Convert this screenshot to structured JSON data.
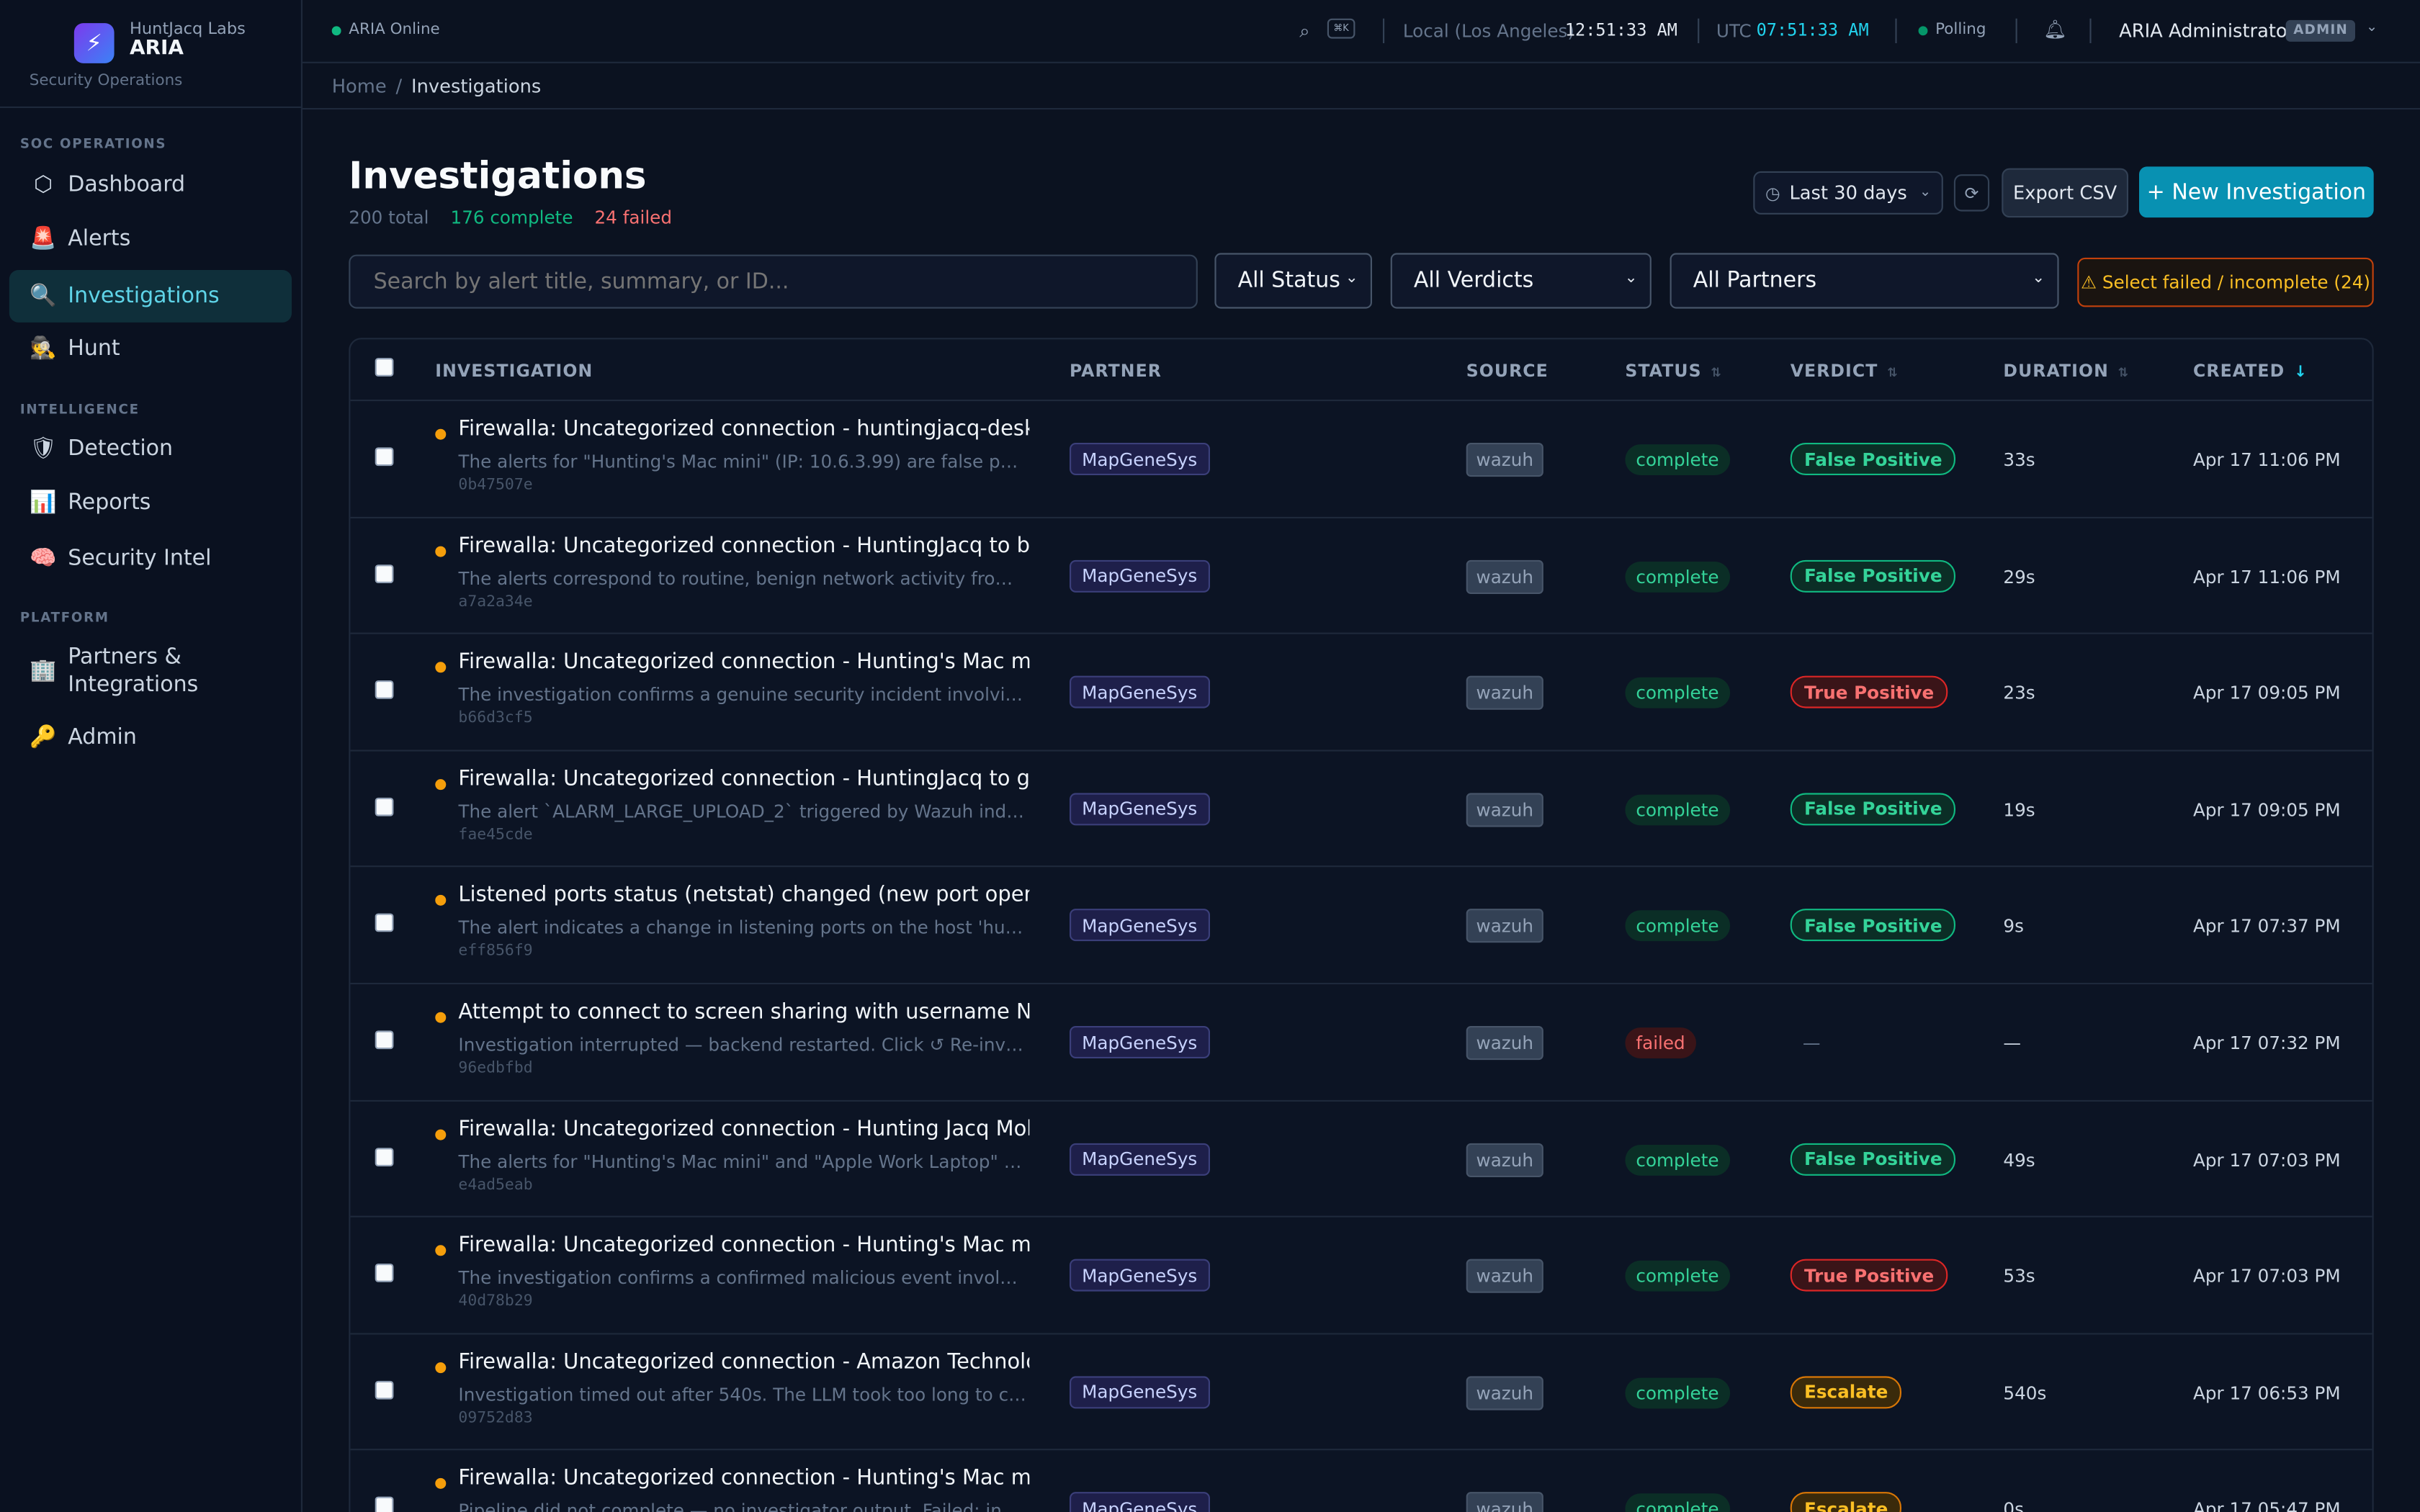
{
  "brand": {
    "org": "HuntJacq Labs",
    "name": "ARIA",
    "subtitle": "Security Operations"
  },
  "sidebar": {
    "sections": [
      {
        "label": "SOC OPERATIONS"
      },
      {
        "label": "INTELLIGENCE"
      },
      {
        "label": "PLATFORM"
      }
    ],
    "items": [
      {
        "label": "Dashboard",
        "icon": "hexagon-icon",
        "glyph": "⬡"
      },
      {
        "label": "Alerts",
        "icon": "siren-icon",
        "glyph": "🚨"
      },
      {
        "label": "Investigations",
        "icon": "magnifier-icon",
        "glyph": "🔍",
        "active": true
      },
      {
        "label": "Hunt",
        "icon": "detective-icon",
        "glyph": "🕵"
      },
      {
        "label": "Detection",
        "icon": "shield-icon",
        "glyph": "🛡"
      },
      {
        "label": "Reports",
        "icon": "chart-icon",
        "glyph": "📊"
      },
      {
        "label": "Security Intel",
        "icon": "brain-icon",
        "glyph": "🧠"
      },
      {
        "label": "Partners & Integrations",
        "icon": "building-icon",
        "glyph": "🏢"
      },
      {
        "label": "Admin",
        "icon": "key-icon",
        "glyph": "🔑"
      }
    ]
  },
  "topbar": {
    "status": "ARIA Online",
    "kbd": "⌘K",
    "local_label": "Local (Los Angeles)",
    "local_time": "12:51:33 AM",
    "utc_label": "UTC",
    "utc_time": "07:51:33 AM",
    "polling": "Polling",
    "user": "ARIA Administrator",
    "role": "ADMIN"
  },
  "breadcrumb": {
    "home": "Home",
    "current": "Investigations"
  },
  "page": {
    "title": "Investigations",
    "total": "200 total",
    "complete": "176 complete",
    "failed": "24 failed",
    "range": "Last 30 days",
    "export": "Export CSV",
    "new": "+ New Investigation"
  },
  "filters": {
    "search_placeholder": "Search by alert title, summary, or ID...",
    "status": "All Status",
    "verdicts": "All Verdicts",
    "partners": "All Partners",
    "select_failed": "⚠ Select failed / incomplete (24)"
  },
  "table": {
    "columns": [
      "Investigation",
      "Partner",
      "Source",
      "Status",
      "Verdict",
      "Duration",
      "Created"
    ],
    "rows": [
      {
        "title": "Firewalla: Uncategorized connection - huntingjacq-desktop to",
        "summary": "The alerts for \"Hunting's Mac mini\" (IP: 10.6.3.99) are false positives ...",
        "id": "0b47507e",
        "partner": "MapGeneSys",
        "source": "wazuh",
        "status": "complete",
        "verdict": "False Positive",
        "vclass": "fp",
        "duration": "33s",
        "created": "Apr 17 11:06 PM"
      },
      {
        "title": "Firewalla: Uncategorized connection - HuntingJacq to bag.itu",
        "summary": "The alerts correspond to routine, benign network activity from the u...",
        "id": "a7a2a34e",
        "partner": "MapGeneSys",
        "source": "wazuh",
        "status": "complete",
        "verdict": "False Positive",
        "vclass": "fp",
        "duration": "29s",
        "created": "Apr 17 11:06 PM"
      },
      {
        "title": "Firewalla: Uncategorized connection - Hunting's Mac mini to",
        "summary": "The investigation confirms a genuine security incident involving the ...",
        "id": "b66d3cf5",
        "partner": "MapGeneSys",
        "source": "wazuh",
        "status": "complete",
        "verdict": "True Positive",
        "vclass": "tp",
        "duration": "23s",
        "created": "Apr 17 09:05 PM"
      },
      {
        "title": "Firewalla: Uncategorized connection - HuntingJacq to gatewa",
        "summary": "The alert `ALARM_LARGE_UPLOAD_2` triggered by Wazuh indicates a...",
        "id": "fae45cde",
        "partner": "MapGeneSys",
        "source": "wazuh",
        "status": "complete",
        "verdict": "False Positive",
        "vclass": "fp",
        "duration": "19s",
        "created": "Apr 17 09:05 PM"
      },
      {
        "title": "Listened ports status (netstat) changed (new port opened or",
        "summary": "The alert indicates a change in listening ports on the host 'huntings....",
        "id": "eff856f9",
        "partner": "MapGeneSys",
        "source": "wazuh",
        "status": "complete",
        "verdict": "False Positive",
        "vclass": "fp",
        "duration": "9s",
        "created": "Apr 17 07:37 PM"
      },
      {
        "title": "Attempt to connect to screen sharing with username N/A fro",
        "summary": "Investigation interrupted — backend restarted. Click ↺ Re-investigate.",
        "id": "96edbfbd",
        "partner": "MapGeneSys",
        "source": "wazuh",
        "status": "failed",
        "verdict": "—",
        "vclass": "none",
        "duration": "—",
        "created": "Apr 17 07:32 PM"
      },
      {
        "title": "Firewalla: Uncategorized connection - Hunting Jacq Mobile to",
        "summary": "The alerts for \"Hunting's Mac mini\" and \"Apple Work Laptop\" are fals...",
        "id": "e4ad5eab",
        "partner": "MapGeneSys",
        "source": "wazuh",
        "status": "complete",
        "verdict": "False Positive",
        "vclass": "fp",
        "duration": "49s",
        "created": "Apr 17 07:03 PM"
      },
      {
        "title": "Firewalla: Uncategorized connection - Hunting's Mac mini to",
        "summary": "The investigation confirms a confirmed malicious event involving th...",
        "id": "40d78b29",
        "partner": "MapGeneSys",
        "source": "wazuh",
        "status": "complete",
        "verdict": "True Positive",
        "vclass": "tp",
        "duration": "53s",
        "created": "Apr 17 07:03 PM"
      },
      {
        "title": "Firewalla: Uncategorized connection - Amazon Technologies",
        "summary": "Investigation timed out after 540s. The LLM took too long to comple...",
        "id": "09752d83",
        "partner": "MapGeneSys",
        "source": "wazuh",
        "status": "complete",
        "verdict": "Escalate",
        "vclass": "es",
        "duration": "540s",
        "created": "Apr 17 06:53 PM"
      },
      {
        "title": "Firewalla: Uncategorized connection - Hunting's Mac mini to",
        "summary": "Pipeline did not complete — no investigator output. Failed: investiga...",
        "id": "",
        "partner": "MapGeneSys",
        "source": "wazuh",
        "status": "complete",
        "verdict": "Escalate",
        "vclass": "es",
        "duration": "0s",
        "created": "Apr 17 05:47 PM"
      }
    ]
  },
  "colors": {
    "accent": "#0891b2",
    "bg": "#0b1220",
    "ok": "#10b981",
    "bad": "#f87171",
    "warn": "#f59e0b"
  }
}
